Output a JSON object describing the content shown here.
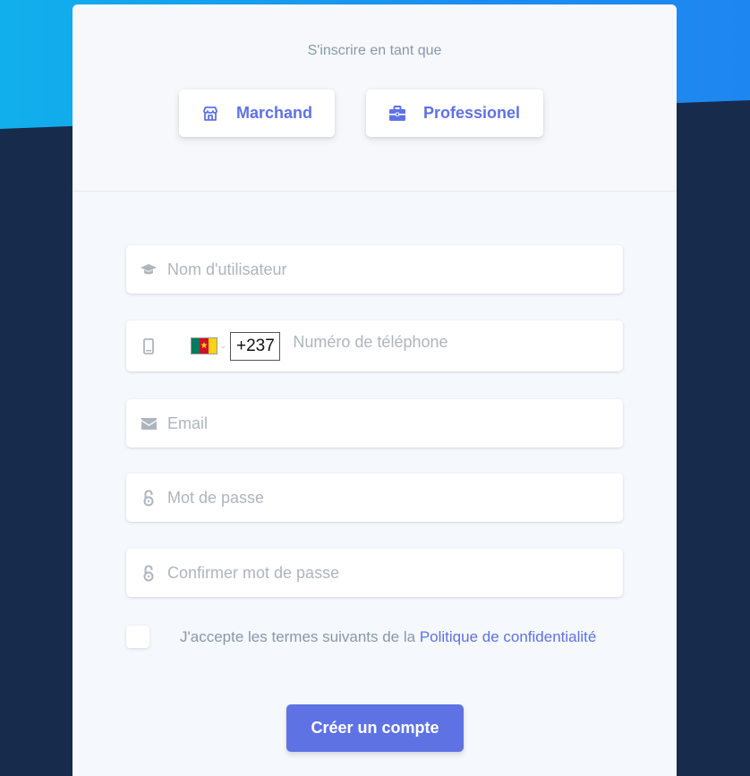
{
  "header": {
    "signup_label": "S'inscrire en tant que",
    "roles": [
      {
        "label": "Marchand",
        "icon": "store-icon"
      },
      {
        "label": "Professionel",
        "icon": "briefcase-icon"
      }
    ]
  },
  "form": {
    "username": {
      "placeholder": "Nom d'utilisateur",
      "value": "",
      "icon": "graduation-cap-icon"
    },
    "phone": {
      "placeholder": "Numéro de téléphone",
      "value": "",
      "icon": "mobile-icon",
      "country_flag": "cameroon-flag-icon",
      "dial_code": "+237"
    },
    "email": {
      "placeholder": "Email",
      "value": "",
      "icon": "envelope-icon"
    },
    "password": {
      "placeholder": "Mot de passe",
      "value": "",
      "icon": "unlock-icon"
    },
    "confirm_password": {
      "placeholder": "Confirmer mot de passe",
      "value": "",
      "icon": "unlock-icon"
    },
    "terms": {
      "text": "J'accepte les termes suivants de la ",
      "link": "Politique de confidentialité",
      "checked": false
    },
    "submit_label": "Créer un compte"
  },
  "colors": {
    "primary": "#5e72e4",
    "background_dark": "#172b4d",
    "background_blue": "#11b0ec",
    "card": "#f5f8fc",
    "placeholder": "#adb5bd",
    "muted_text": "#8898aa"
  }
}
